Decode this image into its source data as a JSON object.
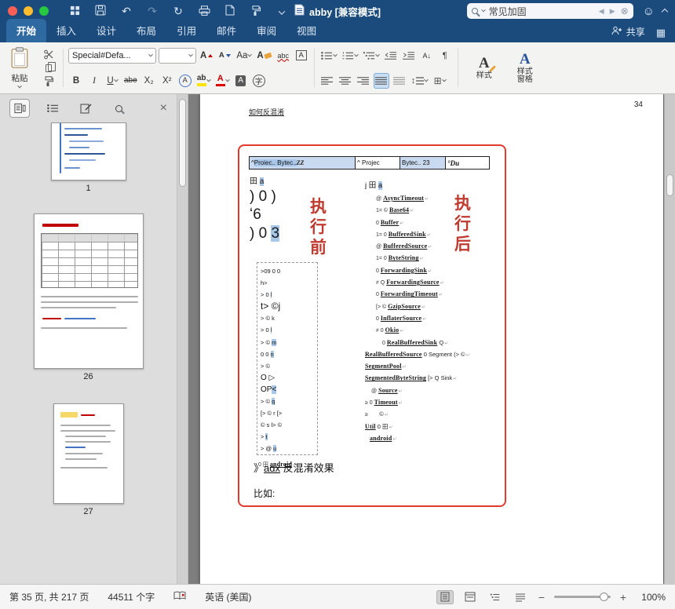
{
  "titlebar": {
    "title": "abby [兼容模式]",
    "search_value": "常见加固",
    "smiley": "☺"
  },
  "tabs": {
    "items": [
      "开始",
      "插入",
      "设计",
      "布局",
      "引用",
      "邮件",
      "审阅",
      "视图"
    ],
    "active": 0,
    "share": "共享"
  },
  "ribbon": {
    "paste": "粘贴",
    "font_name": "Special#Defa...",
    "font_size": "",
    "grow": "A",
    "shrink": "A",
    "case_btn": "Aa",
    "clear": "A",
    "spell": "abc",
    "char_border": "A",
    "bold": "B",
    "italic": "I",
    "underline": "U",
    "strike": "abe",
    "subscript": "X₂",
    "superscript": "X²",
    "outline": "A",
    "font_color": "A",
    "shading": "A",
    "enclose": "字",
    "sort": "A↓",
    "pilcrow": "¶",
    "borders": "⊞",
    "styles": "样式",
    "style_pane": "样式\n窗格"
  },
  "sidebar": {
    "pages": [
      {
        "label": "1"
      },
      {
        "label": "26"
      },
      {
        "label": "27"
      }
    ]
  },
  "document": {
    "header_note": "如何反混淆",
    "page_number": "34",
    "table": {
      "c1_pre": "^ ",
      "c1_hl": "Proiec.. Bytec..",
      "c1_bi": " ZZ",
      "c2": "^ Projec",
      "c3": "Bytec.. 23",
      "c4": "°Du"
    },
    "glyph_lines": [
      {
        "segs": [
          [
            "田 ",
            0
          ],
          [
            "a",
            1
          ]
        ],
        "size": 10
      },
      {
        "segs": [
          [
            ") 0 )",
            0
          ]
        ],
        "size": 19
      },
      {
        "segs": [
          [
            "ʻ6",
            0
          ]
        ],
        "size": 19
      },
      {
        "segs": [
          [
            ") 0 ",
            0
          ],
          [
            "3",
            1
          ]
        ],
        "size": 19
      }
    ],
    "before_label": "执行前",
    "after_label": "执行后",
    "left_lines": [
      {
        "s": [
          [
            ">09 0 0",
            0
          ]
        ]
      },
      {
        "s": [
          [
            "h>",
            0
          ]
        ]
      },
      {
        "s": [
          [
            "> 0 ",
            0
          ],
          [
            "l",
            1
          ]
        ]
      },
      {
        "s": [
          [
            "t> ©j",
            0
          ]
        ],
        "size": 12
      },
      {
        "s": [
          [
            "> © k",
            0
          ]
        ]
      },
      {
        "s": [
          [
            "> 0 ",
            0
          ],
          [
            "l",
            1
          ]
        ]
      },
      {
        "s": [
          [
            "> © ",
            0
          ],
          [
            "m",
            1
          ]
        ]
      },
      {
        "s": [
          [
            "0 0 ",
            0
          ],
          [
            "n",
            1
          ]
        ]
      },
      {
        "s": [
          [
            "> ©",
            0
          ]
        ]
      },
      {
        "s": [
          [
            "O ▷",
            0
          ]
        ],
        "size": 10
      },
      {
        "s": [
          [
            "OP",
            0
          ],
          [
            "<",
            1
          ]
        ],
        "size": 10
      },
      {
        "s": [
          [
            "> © ",
            0
          ],
          [
            "q",
            1
          ]
        ]
      },
      {
        "s": [
          [
            "[> © r [>",
            0
          ]
        ]
      },
      {
        "s": [
          [
            "© s l> ©",
            0
          ]
        ]
      },
      {
        "s": [
          [
            "> ",
            0
          ],
          [
            "t",
            1
          ]
        ]
      },
      {
        "s": [
          [
            "> @ ",
            0
          ],
          [
            "u",
            1
          ]
        ]
      }
    ],
    "android_line": {
      "p": "0 田",
      "n": "android",
      "x": "",
      "i": 0
    },
    "right_header": {
      "pre": "j 田 ",
      "hl": "a"
    },
    "right_items": [
      {
        "p": "@",
        "n": "AsyncTimeout",
        "x": "",
        "i": 14
      },
      {
        "p": "1= ©",
        "n": "Base64",
        "x": "",
        "i": 14
      },
      {
        "p": "0",
        "n": "Buffer",
        "x": "",
        "i": 14
      },
      {
        "p": "1= 0",
        "n": "BufferedSink",
        "x": "",
        "i": 14
      },
      {
        "p": "@",
        "n": "BufferedSource",
        "x": "",
        "i": 14
      },
      {
        "p": "1= 0",
        "n": "ByteString",
        "x": "",
        "i": 14
      },
      {
        "p": "0",
        "n": "ForwardingSink",
        "x": "",
        "i": 14
      },
      {
        "p": "≠ Q",
        "n": "ForwardingSource",
        "x": "",
        "i": 14
      },
      {
        "p": "0",
        "n": "ForwardingTimeout",
        "x": "",
        "i": 14
      },
      {
        "p": "[> ©",
        "n": "GzipSource",
        "x": "",
        "i": 14
      },
      {
        "p": "0",
        "n": "InflaterSource",
        "x": "",
        "i": 14
      },
      {
        "p": "≠ 0",
        "n": "Okio",
        "x": "",
        "i": 14
      },
      {
        "p": "0",
        "n": "RealBufferedSink",
        "x": " Q",
        "i": 22
      },
      {
        "p": "",
        "n": "RealBufferedSource",
        "x": " 0 Segment (> ©",
        "i": 0
      },
      {
        "p": "",
        "n": "SegmentPool",
        "x": "",
        "i": 0
      },
      {
        "p": "",
        "n": "SegmentedByteString",
        "x": " [> Q Sink",
        "i": 0
      },
      {
        "p": "@",
        "n": "Source",
        "x": "",
        "i": 8
      },
      {
        "p": "≥ 0",
        "n": "Timeout",
        "x": "",
        "i": 0
      },
      {
        "p": "≥",
        "n": "",
        "x": "      ©",
        "i": 0
      },
      {
        "p": "",
        "n": "Util",
        "x": " 0 田",
        "i": 0
      },
      {
        "p": "",
        "n": "android",
        "x": "",
        "i": 6
      }
    ],
    "mark": "↵",
    "caption_pre": "》",
    "caption_link": "adx",
    "caption_rest": " 反混淆效果",
    "example": "比如:"
  },
  "statusbar": {
    "page_info": "第 35 页, 共 217 页",
    "word_count": "44511 个字",
    "language": "英语 (美国)",
    "zoom": "100%",
    "minus": "−",
    "plus": "+"
  }
}
